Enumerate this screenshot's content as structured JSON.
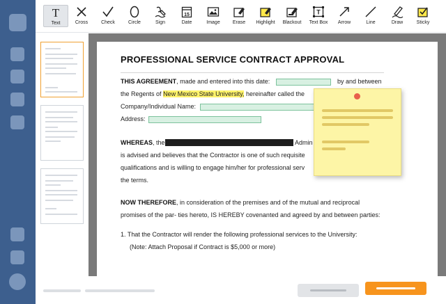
{
  "toolbar": {
    "tools": [
      {
        "label": "Text",
        "icon": "text-icon"
      },
      {
        "label": "Cross",
        "icon": "cross-icon"
      },
      {
        "label": "Check",
        "icon": "check-icon"
      },
      {
        "label": "Circle",
        "icon": "circle-icon"
      },
      {
        "label": "Sign",
        "icon": "sign-icon"
      },
      {
        "label": "Date",
        "icon": "date-icon"
      },
      {
        "label": "Image",
        "icon": "image-icon"
      },
      {
        "label": "Erase",
        "icon": "erase-icon"
      },
      {
        "label": "Highlight",
        "icon": "highlight-icon"
      },
      {
        "label": "Blackout",
        "icon": "blackout-icon"
      },
      {
        "label": "Text Box",
        "icon": "text-box-icon"
      },
      {
        "label": "Arrow",
        "icon": "arrow-icon"
      },
      {
        "label": "Line",
        "icon": "line-icon"
      },
      {
        "label": "Draw",
        "icon": "draw-icon"
      },
      {
        "label": "Sticky",
        "icon": "sticky-icon"
      }
    ],
    "active_tool": "Text",
    "date_icon_number": "15",
    "text_box_glyph": "T"
  },
  "document": {
    "title": "PROFESSIONAL SERVICE CONTRACT APPROVAL",
    "p1_bold": "THIS AGREEMENT",
    "p1_a": ", made and entered into this date:",
    "p1_b": "by and between",
    "p2_a": "the Regents of",
    "p2_highlight": "New Mexico State University,",
    "p2_b": "hereinafter called the",
    "p3_label": "Company/Individual Name:",
    "p4_label": "Address:",
    "p5_bold": "WHEREAS",
    "p5_a": ", the",
    "p5_b": "Admin",
    "p6": "is advised and believes that the Contractor is one of such requisite",
    "p7": "qualifications and is willing to engage him/her for professional serv",
    "p8": "the terms.",
    "p9_bold": "NOW THEREFORE",
    "p9_a": ", in consideration of the premises and of the mutual and reciprocal",
    "p10": "promises of the par- ties hereto, IS HEREBY covenanted and agreed by and between parties:",
    "p11": "1. That the Contractor will render the following professional services to the University:",
    "p12": "(Note: Attach Proposal if Contract is $5,000 or more)"
  },
  "colors": {
    "rail": "#3d5f8e",
    "accent": "#f7941d",
    "highlight": "#fff36a",
    "field": "#d8f0e2",
    "sticky": "#fdf5a6"
  }
}
